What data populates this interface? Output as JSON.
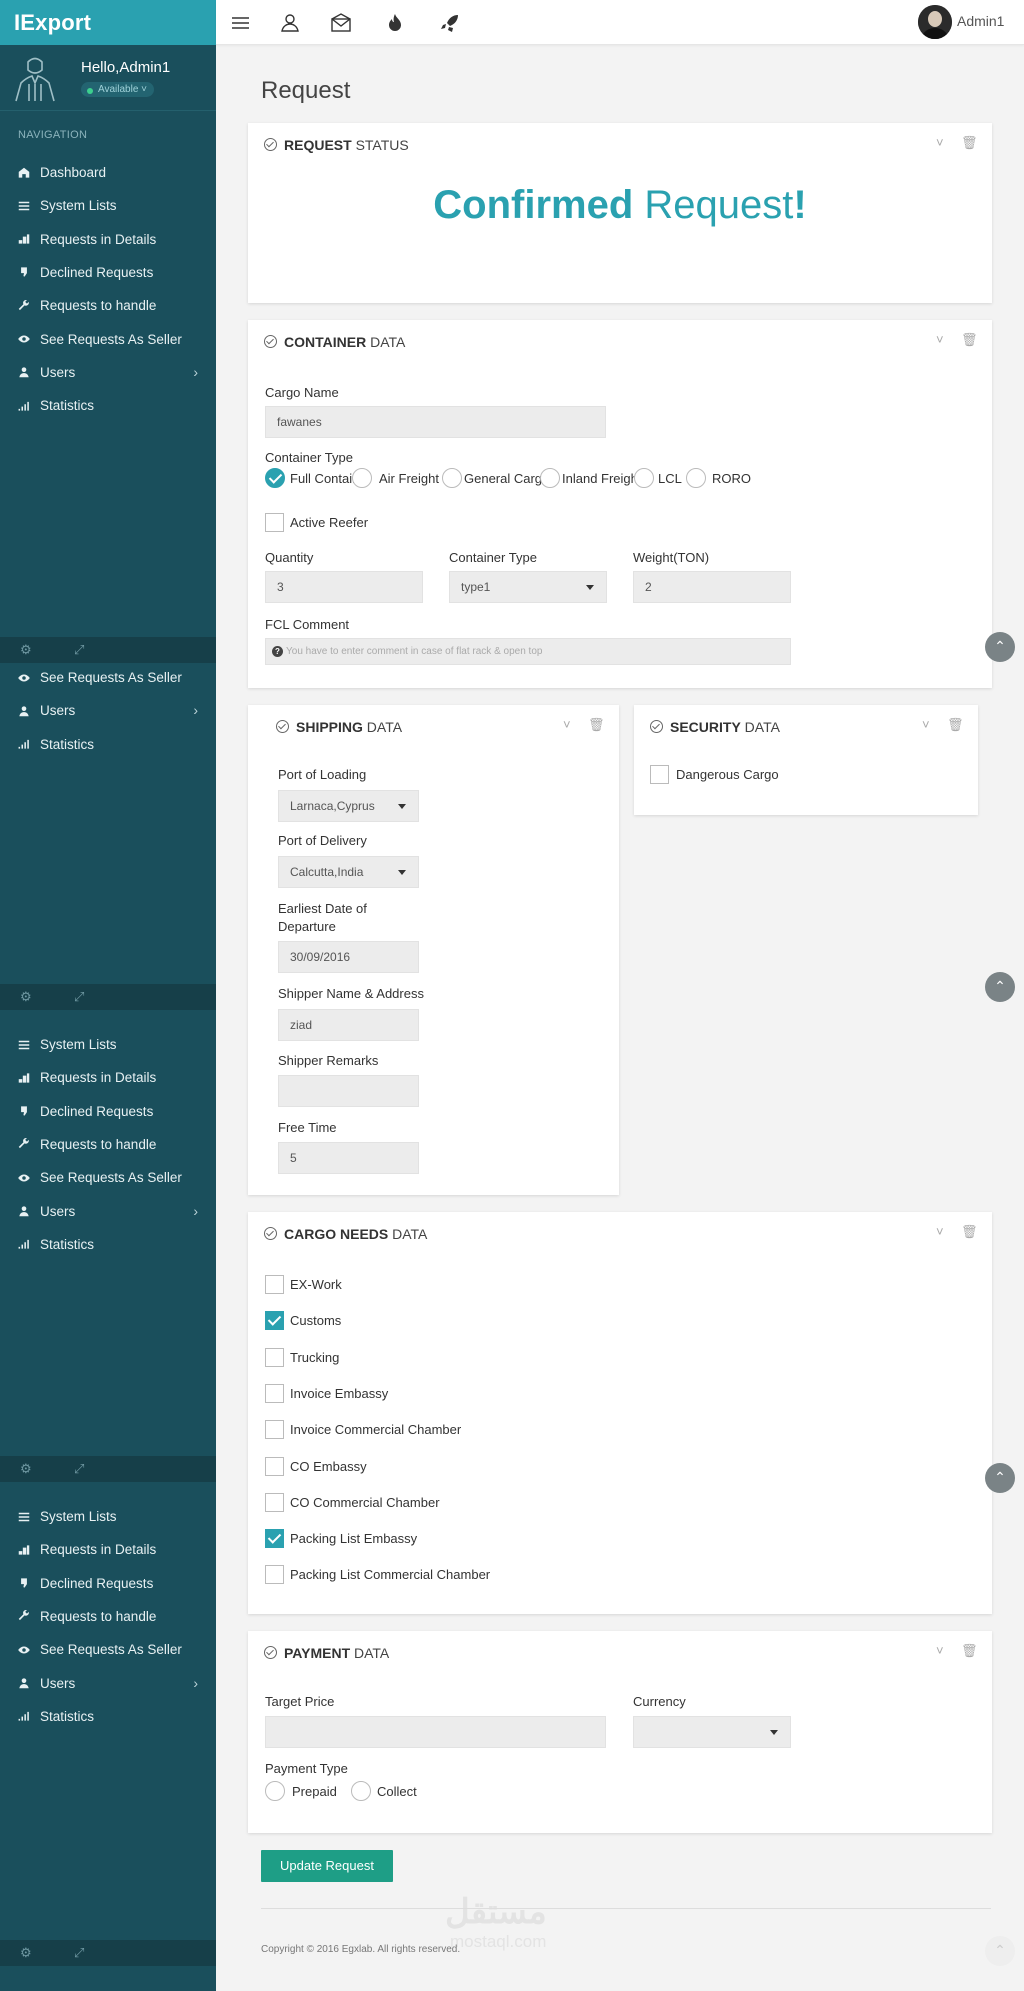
{
  "brand": "IExport",
  "user": {
    "greeting": "Hello,Admin1",
    "status": "Available"
  },
  "nav": {
    "label": "NAVIGATION",
    "items": [
      "Dashboard",
      "System Lists",
      "Requests in Details",
      "Declined Requests",
      "Requests to handle",
      "See Requests As Seller",
      "Users",
      "Statistics"
    ]
  },
  "topbar": {
    "admin": "Admin1",
    "icons": [
      "menu-icon",
      "user-icon",
      "mail-icon",
      "fire-icon",
      "rocket-icon"
    ]
  },
  "page": {
    "title": "Request"
  },
  "status_panel": {
    "title_bold": "REQUEST",
    "title_rest": " STATUS",
    "word1": "Confirmed",
    "word2": " Request",
    "bang": "!"
  },
  "container": {
    "title_bold": "CONTAINER",
    "title_rest": " DATA",
    "cargo_name_label": "Cargo Name",
    "cargo_name": "fawanes",
    "type_label": "Container Type",
    "types": [
      "Full Container",
      "Air Freight",
      "General Cargo",
      "Inland Freight",
      "LCL",
      "RORO"
    ],
    "selected_type": 0,
    "active_reefer": "Active Reefer",
    "quantity_label": "Quantity",
    "quantity": "3",
    "ctype_label": "Container Type",
    "ctype": "type1",
    "weight_label": "Weight(TON)",
    "weight": "2",
    "fcl_label": "FCL Comment",
    "fcl_placeholder": "You have to enter comment in case of flat rack & open top"
  },
  "shipping": {
    "title_bold": "SHIPPING",
    "title_rest": " DATA",
    "pol_label": "Port of Loading",
    "pol": "Larnaca,Cyprus",
    "pod_label": "Port of Delivery",
    "pod": "Calcutta,India",
    "edd_label_1": "Earliest Date of",
    "edd_label_2": "Departure",
    "edd": "30/09/2016",
    "shipper_label": "Shipper Name & Address",
    "shipper": "ziad",
    "remarks_label": "Shipper Remarks",
    "remarks": "",
    "free_label": "Free Time",
    "free": "5"
  },
  "security": {
    "title_bold": "SECURITY",
    "title_rest": " DATA",
    "dangerous": "Dangerous Cargo"
  },
  "cargo_needs": {
    "title_bold": "CARGO NEEDS",
    "title_rest": " DATA",
    "items": [
      {
        "label": "EX-Work",
        "checked": false
      },
      {
        "label": "Customs",
        "checked": true
      },
      {
        "label": "Trucking",
        "checked": false
      },
      {
        "label": "Invoice Embassy",
        "checked": false
      },
      {
        "label": "Invoice Commercial Chamber",
        "checked": false
      },
      {
        "label": "CO Embassy",
        "checked": false
      },
      {
        "label": "CO Commercial Chamber",
        "checked": false
      },
      {
        "label": "Packing List Embassy",
        "checked": true
      },
      {
        "label": "Packing List Commercial Chamber",
        "checked": false
      }
    ]
  },
  "payment": {
    "title_bold": "PAYMENT",
    "title_rest": " DATA",
    "target_label": "Target Price",
    "target": "",
    "currency_label": "Currency",
    "currency": "",
    "ptype_label": "Payment Type",
    "prepaid": "Prepaid",
    "collect": "Collect"
  },
  "actions": {
    "update": "Update Request"
  },
  "footer": {
    "copyright": "Copyright © 2016 Egxlab. All rights reserved."
  },
  "watermark": {
    "ar": "مستقل",
    "en": "mostaql.com"
  },
  "colors": {
    "accent": "#2aa1b0",
    "sidebar": "#1a4f5c",
    "button": "#1e9e86"
  }
}
